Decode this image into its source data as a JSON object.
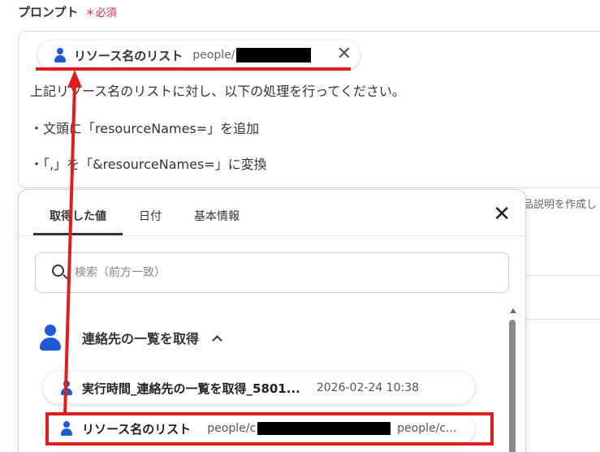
{
  "field": {
    "label": "プロンプト",
    "required": "＊必須"
  },
  "chip": {
    "label": "リソース名のリスト",
    "value": "people/"
  },
  "prompt_lines": [
    "上記リソース名のリストに対し、以下の処理を行ってください。",
    "・文頭に「resourceNames=」を追加",
    "・「,」を「&resourceNames=」に変換"
  ],
  "side_text": "品説明を作成し",
  "popup": {
    "tabs": [
      "取得した値",
      "日付",
      "基本情報"
    ],
    "active_tab": 0,
    "search_placeholder": "検索（前方一致）",
    "group_label": "連絡先の一覧を取得",
    "rows": [
      {
        "label": "実行時間_連絡先の一覧を取得_5801...",
        "meta": "2026-02-24 10:38"
      },
      {
        "label": "リソース名のリスト",
        "meta": "people/c",
        "meta2": "people/c..."
      }
    ]
  },
  "icons": [
    "person-icon",
    "close-icon",
    "search-icon",
    "chevron-up-icon"
  ],
  "colors": {
    "highlight": "#e01e1e",
    "person": "#1d5bd6",
    "required": "#e0245e"
  }
}
